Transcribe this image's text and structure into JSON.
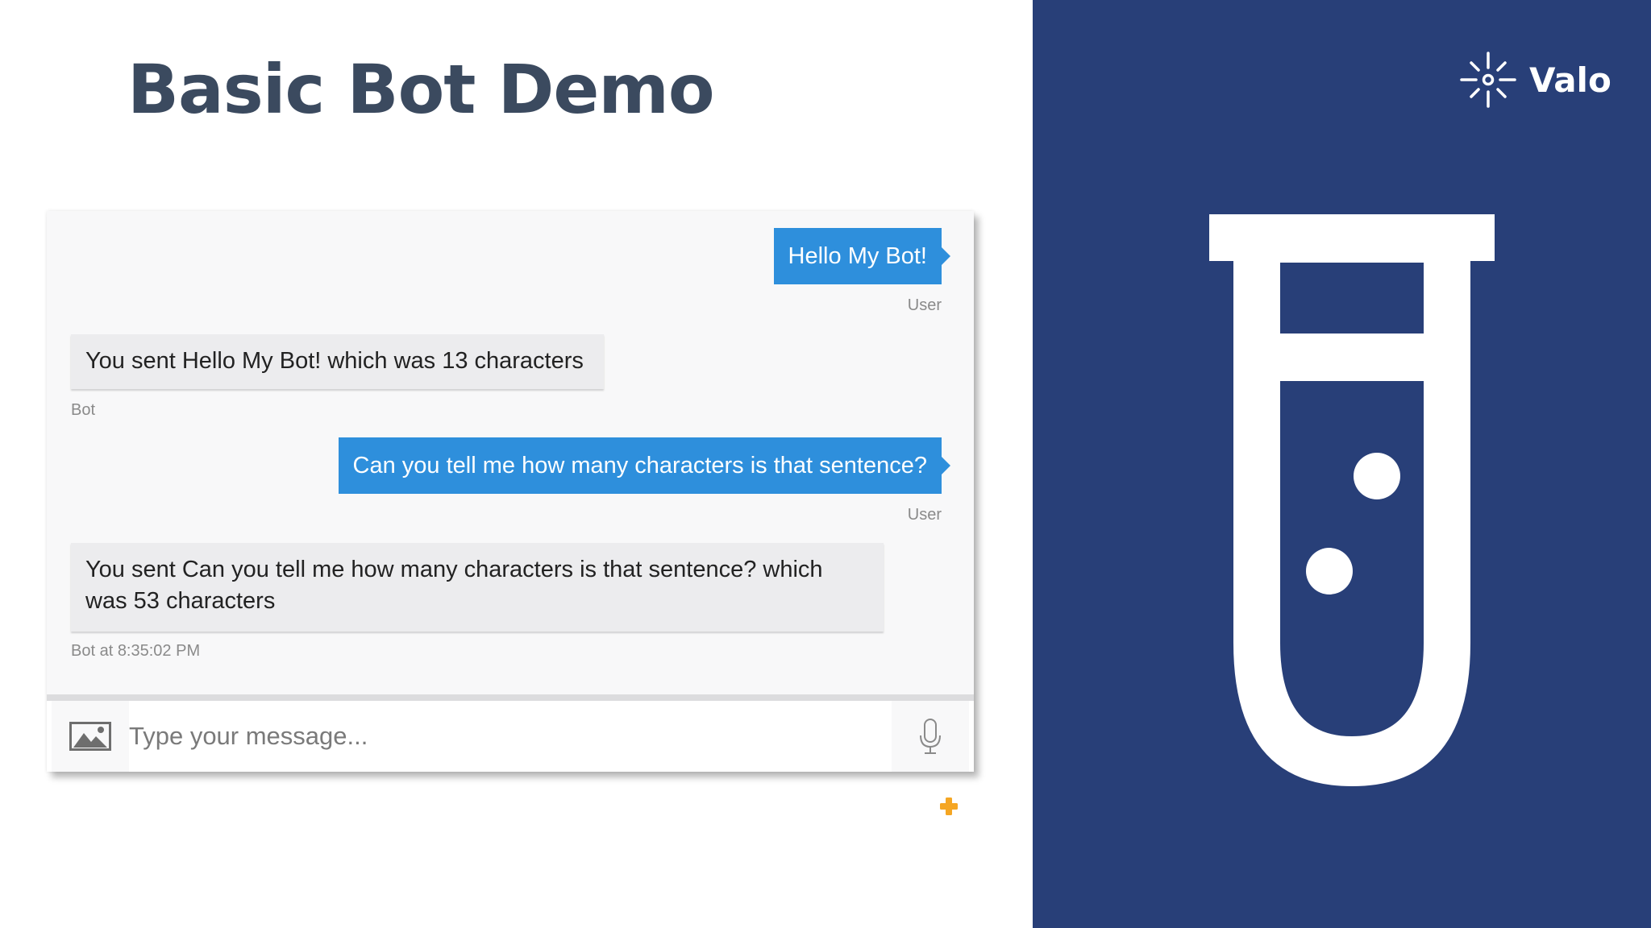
{
  "slide": {
    "title": "Basic Bot Demo"
  },
  "brand": {
    "name": "Valo",
    "logo_icon": "sparkle-logo-icon"
  },
  "chat": {
    "messages": [
      {
        "from": "user",
        "text": "Hello My Bot!",
        "meta": "User"
      },
      {
        "from": "bot",
        "text": "You sent Hello My Bot! which was 13 characters",
        "meta": "Bot"
      },
      {
        "from": "user",
        "text": "Can you tell me how many characters is that sentence?",
        "meta": "User"
      },
      {
        "from": "bot",
        "text_line1": "You sent Can you tell me how many characters is that sentence? which",
        "text_line2": "was 53 characters",
        "meta": "Bot at 8:35:02 PM"
      }
    ],
    "input": {
      "placeholder": "Type your message..."
    },
    "icons": {
      "upload": "image-upload-icon",
      "mic": "microphone-icon",
      "plus": "plus-icon"
    }
  },
  "illustration": {
    "icon": "test-tube-icon"
  },
  "colors": {
    "title": "#3b4a5f",
    "user_bubble": "#2e8fdc",
    "bot_bubble": "#ececee",
    "panel": "#283f78",
    "plus": "#f5a623"
  }
}
